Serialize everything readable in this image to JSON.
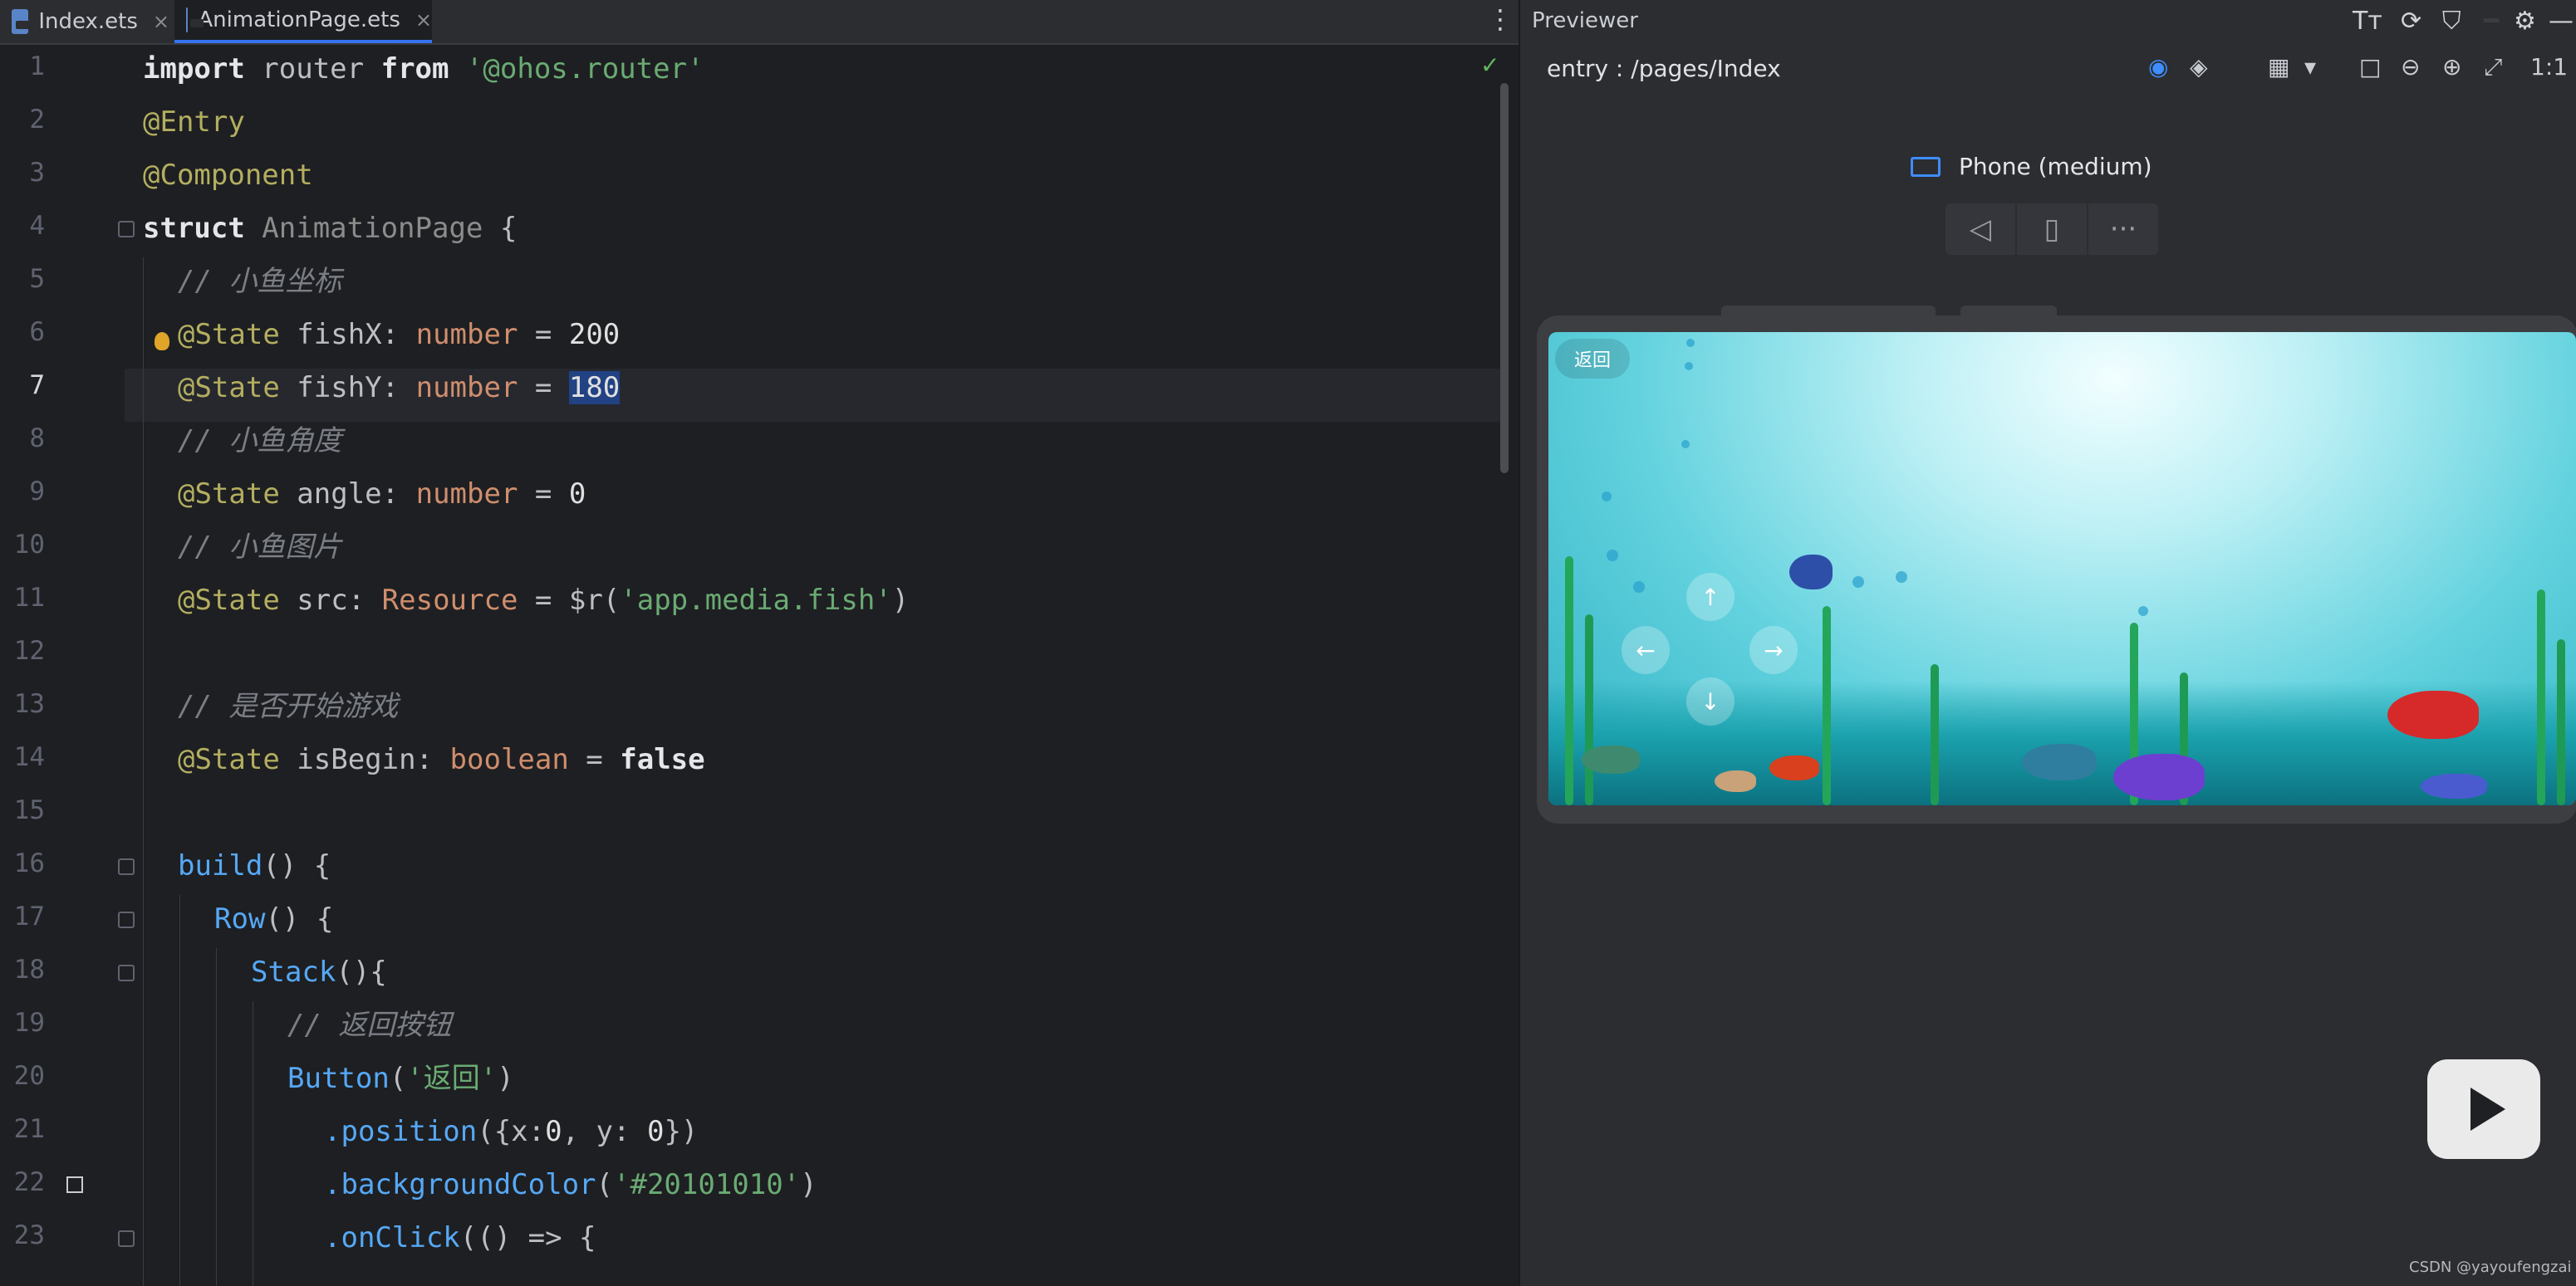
{
  "editor": {
    "tabs": [
      {
        "label": "Index.ets",
        "close": "×"
      },
      {
        "label": "AnimationPage.ets",
        "close": "×"
      }
    ],
    "more_icon": "⋮",
    "status_icon": "✓",
    "current_line": 7,
    "lines": [
      {
        "n": "1"
      },
      {
        "n": "2"
      },
      {
        "n": "3"
      },
      {
        "n": "4"
      },
      {
        "n": "5"
      },
      {
        "n": "6"
      },
      {
        "n": "7"
      },
      {
        "n": "8"
      },
      {
        "n": "9"
      },
      {
        "n": "10"
      },
      {
        "n": "11"
      },
      {
        "n": "12"
      },
      {
        "n": "13"
      },
      {
        "n": "14"
      },
      {
        "n": "15"
      },
      {
        "n": "16"
      },
      {
        "n": "17"
      },
      {
        "n": "18"
      },
      {
        "n": "19"
      },
      {
        "n": "20"
      },
      {
        "n": "21"
      },
      {
        "n": "22"
      },
      {
        "n": "23"
      }
    ],
    "code": {
      "l1": {
        "a": "import",
        "b": " router ",
        "c": "from",
        "d": " '@ohos.router'"
      },
      "l2": {
        "a": "@Entry"
      },
      "l3": {
        "a": "@Component"
      },
      "l4": {
        "a": "struct",
        "b": " AnimationPage ",
        "c": "{"
      },
      "l5": {
        "a": "// 小鱼坐标"
      },
      "l6": {
        "a": "@State",
        "b": " fishX: ",
        "c": "number",
        "d": " = ",
        "e": "200"
      },
      "l7": {
        "a": "@State",
        "b": " fishY: ",
        "c": "number",
        "d": " = ",
        "e": "180"
      },
      "l8": {
        "a": "// 小鱼角度"
      },
      "l9": {
        "a": "@State",
        "b": " angle: ",
        "c": "number",
        "d": " = ",
        "e": "0"
      },
      "l10": {
        "a": "// 小鱼图片"
      },
      "l11": {
        "a": "@State",
        "b": " src: ",
        "c": "Resource",
        "d": " = ",
        "e": "$r(",
        "f": "'app.media.fish'",
        "g": ")"
      },
      "l13": {
        "a": "// 是否开始游戏"
      },
      "l14": {
        "a": "@State",
        "b": " isBegin: ",
        "c": "boolean",
        "d": " = ",
        "e": "false"
      },
      "l16": {
        "a": "build",
        "b": "() {"
      },
      "l17": {
        "a": "Row",
        "b": "() {"
      },
      "l18": {
        "a": "Stack",
        "b": "(){"
      },
      "l19": {
        "a": "// 返回按钮"
      },
      "l20": {
        "a": "Button",
        "b": "(",
        "c": "'返回'",
        "d": ")"
      },
      "l21": {
        "a": ".position",
        "b": "({x:",
        "c": "0",
        "d": ", y: ",
        "e": "0",
        "f": "})"
      },
      "l22": {
        "a": ".backgroundColor",
        "b": "(",
        "c": "'#20101010'",
        "d": ")"
      },
      "l23": {
        "a": ".onClick",
        "b": "(() => {"
      }
    }
  },
  "previewer": {
    "title": "Previewer",
    "path": "entry : /pages/Index",
    "device_name": "Phone (medium)",
    "device_controls": [
      "◁",
      "▯",
      "···"
    ],
    "header_icons": [
      "Tт",
      "⟳",
      "⛉",
      "━",
      "⚙",
      "—"
    ],
    "toolbar_icons": [
      "◉",
      "◈",
      "▦",
      "▾",
      "□",
      "⊖",
      "⊕",
      "⤢",
      "1:1"
    ],
    "app": {
      "back_label": "返回",
      "up": "↑",
      "left": "←",
      "right": "→",
      "down": "↓"
    }
  },
  "watermark": "CSDN @yayoufengzai",
  "colors": {
    "editor_bg": "#1e1f22",
    "panel_bg": "#2b2d30",
    "accent": "#3574f0",
    "selection": "#214283",
    "sea_top": "#f2feff",
    "sea_bottom": "#2fb0c2"
  }
}
